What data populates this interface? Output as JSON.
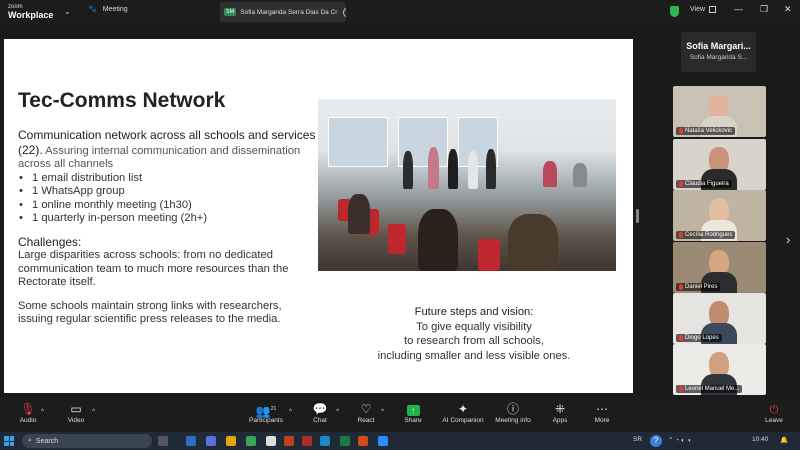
{
  "titlebar": {
    "logo_small": "zoom",
    "logo_big": "Workplace",
    "meeting_label": "Meeting",
    "share_badge": "SM",
    "share_tab_label": "Sofia Margarida Serra Dias Da Cr",
    "view_label": "View"
  },
  "slide": {
    "title": "Tec-Comms Network",
    "intro_heading": "Communication network across all schools and services (22).",
    "intro_rest": " Assuring internal communication and dissemination across all channels",
    "bullets": [
      "1 email distribution list",
      "1 WhatsApp group",
      "1 online monthly meeting (1h30)",
      "1 quarterly in-person meeting (2h+)"
    ],
    "challenges_heading": "Challenges:",
    "challenges_text": "Large disparities across schools: from no dedicated communication team to much more resources than the Rectorate itself.",
    "challenges_text2": "Some schools maintain strong links with researchers, issuing regular scientific press releases to the media.",
    "future_heading": "Future steps and vision:",
    "future_line1": "To give equally visibility",
    "future_line2": "to research from all schools,",
    "future_line3": "including smaller and less visible ones."
  },
  "participants": {
    "self_name_short": "Sofia  Margari...",
    "self_name_sub": "Sofia Margarida S...",
    "tiles": [
      {
        "name": "Nataša Velickovic",
        "bg": "#c9c2b4",
        "face": "#e0b49a",
        "body": "#d8d2c8"
      },
      {
        "name": "Claudia Figueira",
        "bg": "#d8d4cc",
        "face": "#c99378",
        "body": "#2b2b2b"
      },
      {
        "name": "Cecília Rodrigues",
        "bg": "#bfb3a2",
        "face": "#e3bda0",
        "body": "#ece6dc"
      },
      {
        "name": "Daniel Pires",
        "bg": "#9c8b74",
        "face": "#d6a583",
        "body": "#2c2c2c"
      },
      {
        "name": "Diogo Lopes",
        "bg": "#e6e4e0",
        "face": "#c08c6c",
        "body": "#3a4a5a"
      },
      {
        "name": "Leonel Manuel Me...",
        "bg": "#ecebe8",
        "face": "#d0a07f",
        "body": "#30363c"
      }
    ]
  },
  "toolbar": {
    "audio": "Audio",
    "video": "Video",
    "participants": "Participants",
    "participants_count": "21",
    "chat": "Chat",
    "react": "React",
    "share": "Share",
    "ai_companion": "AI Companion",
    "meeting_info": "Meeting info",
    "apps": "Apps",
    "more": "More",
    "leave": "Leave"
  },
  "taskbar": {
    "search_label": "Search",
    "language": "SR",
    "time": "10:40"
  }
}
